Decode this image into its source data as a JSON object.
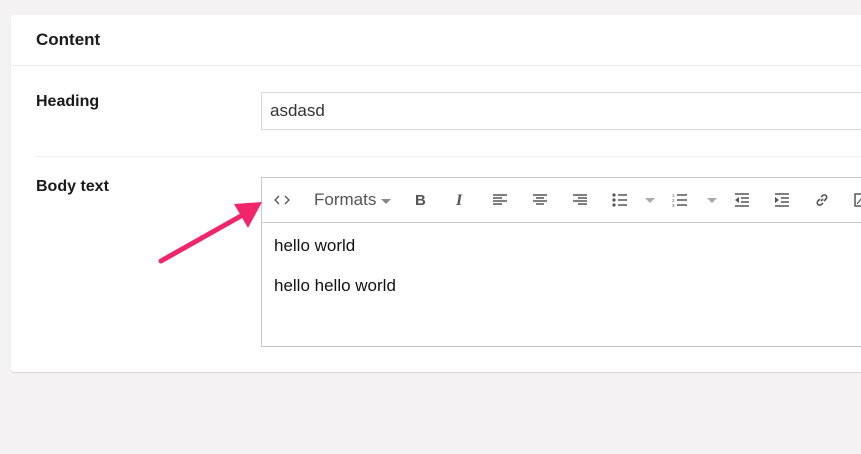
{
  "card": {
    "title": "Content"
  },
  "fields": {
    "heading_label": "Heading",
    "heading_value": "asdasd",
    "body_label": "Body text"
  },
  "editor": {
    "formats_label": "Formats",
    "paragraphs": [
      "hello world",
      "hello hello world"
    ]
  },
  "colors": {
    "annotation_arrow": "#f0256a",
    "background": "#f4f2f2"
  }
}
